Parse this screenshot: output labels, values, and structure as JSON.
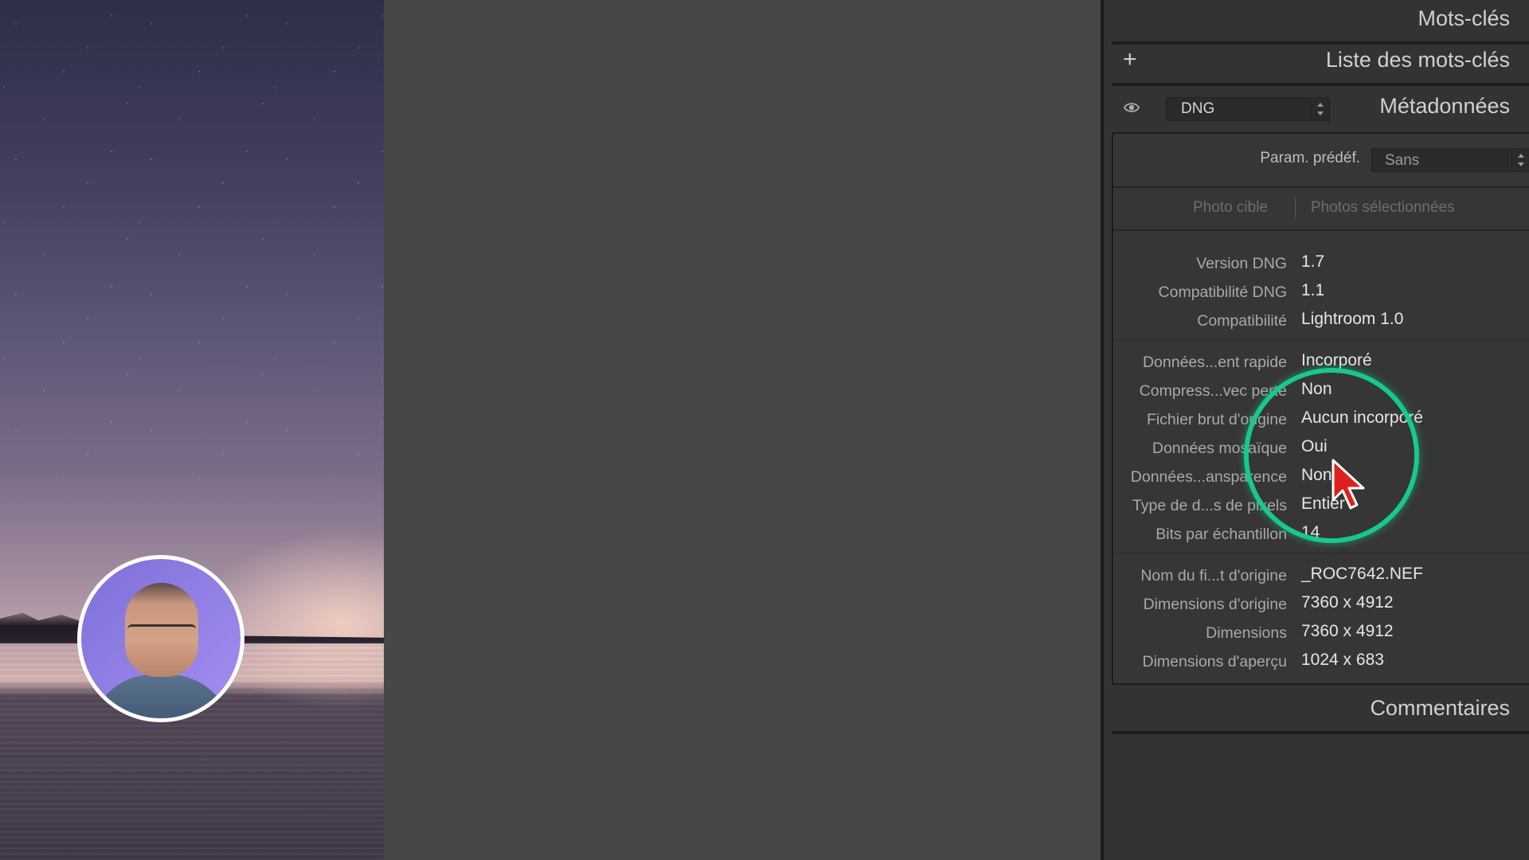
{
  "panel": {
    "keywords_title": "Mots-clés",
    "keyword_list_title": "Liste des mots-clés",
    "metadata_title": "Métadonnées",
    "metadata_set": "DNG",
    "preset_label": "Param. prédéf.",
    "preset_value": "Sans",
    "tab_target": "Photo cible",
    "tab_selected": "Photos sélectionnées",
    "comments_title": "Commentaires",
    "rows": [
      {
        "label": "Version DNG",
        "value": "1.7"
      },
      {
        "label": "Compatibilité DNG",
        "value": "1.1"
      },
      {
        "label": "Compatibilité",
        "value": "Lightroom 1.0"
      },
      {
        "label": "Données...ent rapide",
        "value": "Incorporé"
      },
      {
        "label": "Compress...vec perte",
        "value": "Non"
      },
      {
        "label": "Fichier brut d'origine",
        "value": "Aucun incorporé"
      },
      {
        "label": "Données mosaïque",
        "value": "Oui"
      },
      {
        "label": "Données...ansparence",
        "value": "Non"
      },
      {
        "label": "Type de d...s de pixels",
        "value": "Entier"
      },
      {
        "label": "Bits par échantillon",
        "value": "14"
      },
      {
        "label": "Nom du fi...t d'origine",
        "value": "_ROC7642.NEF"
      },
      {
        "label": "Dimensions d'origine",
        "value": "7360 x 4912"
      },
      {
        "label": "Dimensions",
        "value": "7360 x 4912"
      },
      {
        "label": "Dimensions d'aperçu",
        "value": "1024 x 683"
      }
    ]
  },
  "colors": {
    "highlight_ring": "#17c98a",
    "cursor": "#e02020",
    "panel_bg": "#333333"
  },
  "icons": [
    "plus-icon",
    "eye-icon",
    "cursor-icon"
  ]
}
